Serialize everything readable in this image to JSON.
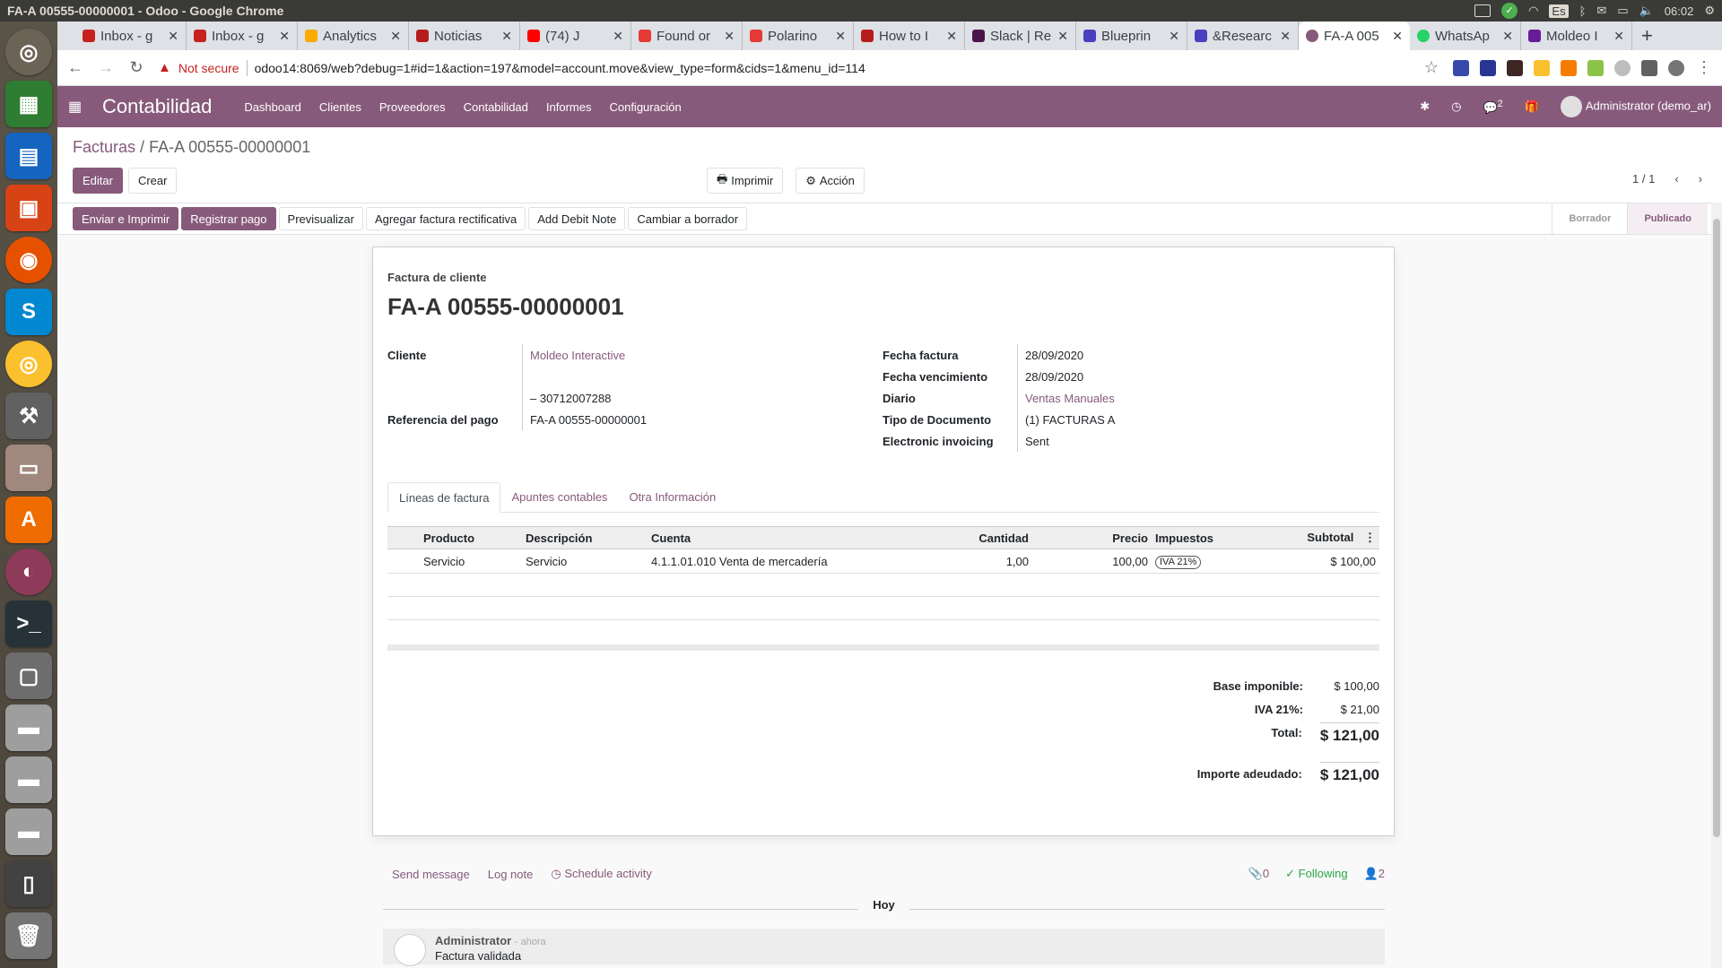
{
  "os": {
    "window_title": "FA-A 00555-00000001 - Odoo - Google Chrome",
    "lang": "Es",
    "clock": "06:02"
  },
  "browser": {
    "tabs": [
      {
        "label": "Inbox - g",
        "icon": "gmail-icon",
        "color": "#c5221f"
      },
      {
        "label": "Inbox - g",
        "icon": "gmail-icon",
        "color": "#c5221f"
      },
      {
        "label": "Analytics",
        "icon": "analytics-icon",
        "color": "#f9ab00"
      },
      {
        "label": "Noticias",
        "icon": "news-icon",
        "color": "#b71c1c"
      },
      {
        "label": "(74) J",
        "icon": "youtube-icon",
        "color": "#ff0000"
      },
      {
        "label": "Found or",
        "icon": "otrs-icon",
        "color": "#e53935"
      },
      {
        "label": "Polarino",
        "icon": "otrs-icon",
        "color": "#e53935"
      },
      {
        "label": "How to I",
        "icon": "article-icon",
        "color": "#b71c1c"
      },
      {
        "label": "Slack | Re",
        "icon": "slack-icon",
        "color": "#4a154b"
      },
      {
        "label": "Blueprin",
        "icon": "launchpad-icon",
        "color": "#4a3fbf"
      },
      {
        "label": "&Researc",
        "icon": "launchpad-icon",
        "color": "#4a3fbf"
      },
      {
        "label": "FA-A 005",
        "icon": "odoo-icon",
        "color": "#875a7b",
        "active": true
      },
      {
        "label": "WhatsAp",
        "icon": "whatsapp-icon",
        "color": "#25d366"
      },
      {
        "label": "Moldeo I",
        "icon": "moldeo-icon",
        "color": "#6a1b9a"
      }
    ],
    "security_label": "Not secure",
    "url": "odoo14:8069/web?debug=1#id=1&action=197&model=account.move&view_type=form&cids=1&menu_id=114"
  },
  "odoo": {
    "app_name": "Contabilidad",
    "menu": [
      "Dashboard",
      "Clientes",
      "Proveedores",
      "Contabilidad",
      "Informes",
      "Configuración"
    ],
    "chat_count": "2",
    "user": "Administrator (demo_ar)",
    "breadcrumb_parent": "Facturas",
    "breadcrumb_current": "FA-A 00555-00000001",
    "edit_label": "Editar",
    "create_label": "Crear",
    "print_label": "Imprimir",
    "action_label": "Acción",
    "pager": "1 / 1",
    "status_buttons": [
      "Enviar e Imprimir",
      "Registrar pago",
      "Previsualizar",
      "Agregar factura rectificativa",
      "Add Debit Note",
      "Cambiar a borrador"
    ],
    "stages": [
      "Borrador",
      "Publicado"
    ],
    "current_stage": "Publicado"
  },
  "invoice": {
    "doc_type": "Factura de cliente",
    "name": "FA-A 00555-00000001",
    "left_fields": {
      "cliente_label": "Cliente",
      "cliente_value": "Moldeo Interactive",
      "vat_value": "– 30712007288",
      "ref_label": "Referencia del pago",
      "ref_value": "FA-A 00555-00000001"
    },
    "right_fields": {
      "fecha_factura_label": "Fecha factura",
      "fecha_factura_value": "28/09/2020",
      "vencimiento_label": "Fecha vencimiento",
      "vencimiento_value": "28/09/2020",
      "diario_label": "Diario",
      "diario_value": "Ventas Manuales",
      "tipo_doc_label": "Tipo de Documento",
      "tipo_doc_value": "(1) FACTURAS A",
      "einvoice_label": "Electronic invoicing",
      "einvoice_value": "Sent"
    },
    "tabs": [
      "Líneas de factura",
      "Apuntes contables",
      "Otra Información"
    ],
    "columns": [
      "Producto",
      "Descripción",
      "Cuenta",
      "Cantidad",
      "Precio",
      "Impuestos",
      "Subtotal"
    ],
    "lines": [
      {
        "producto": "Servicio",
        "descripcion": "Servicio",
        "cuenta": "4.1.1.01.010 Venta de mercadería",
        "cantidad": "1,00",
        "precio": "100,00",
        "impuesto": "IVA 21%",
        "subtotal": "$ 100,00"
      }
    ],
    "totals": {
      "base_label": "Base imponible:",
      "base_value": "$ 100,00",
      "iva_label": "IVA 21%:",
      "iva_value": "$ 21,00",
      "total_label": "Total:",
      "total_value": "$ 121,00",
      "due_label": "Importe adeudado:",
      "due_value": "$ 121,00"
    }
  },
  "chatter": {
    "send_message": "Send message",
    "log_note": "Log note",
    "schedule": "Schedule activity",
    "attachments": "0",
    "following": "Following",
    "followers": "2",
    "day": "Hoy",
    "author": "Administrator",
    "when": "- ahora",
    "body": "Factura validada"
  }
}
